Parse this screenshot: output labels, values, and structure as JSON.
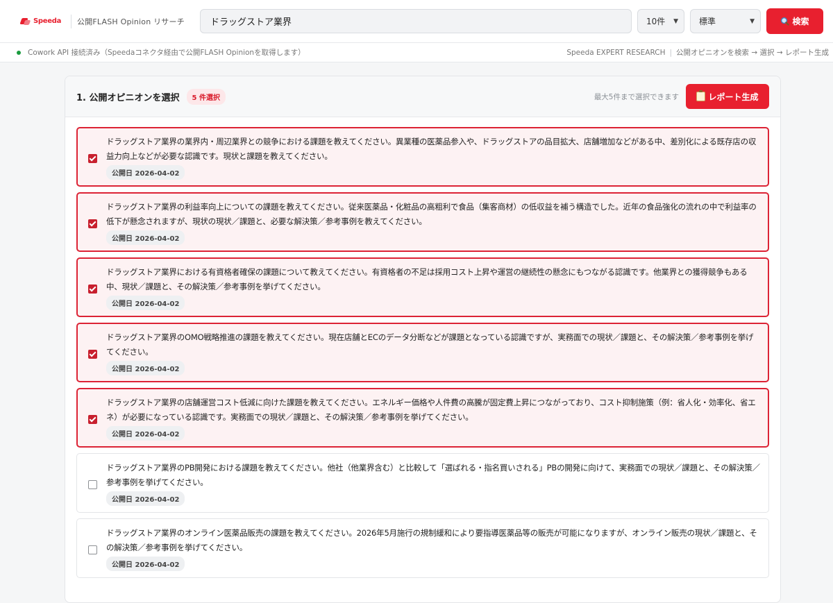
{
  "header": {
    "logo_text": "Speeda",
    "app_name": "公開FLASH Opinion リサーチ",
    "search_value": "ドラッグストア業界",
    "count_select": "10件",
    "mode_select": "標準",
    "search_button": "検索"
  },
  "status": {
    "connection": "Cowork API 接続済み（Speedaコネクタ経由で公開FLASH Opinionを取得します）",
    "brand": "Speeda EXPERT RESEARCH",
    "flow": "公開オピニオンを検索 → 選択 → レポート生成"
  },
  "panel": {
    "title": "1. 公開オピニオンを選択",
    "selected_badge": "5 件選択",
    "limit_note": "最大5件まで選択できます",
    "report_button": "レポート生成"
  },
  "items": [
    {
      "text": "ドラッグストア業界の業界内・周辺業界との競争における課題を教えてください。異業種の医薬品参入や、ドラッグストアの品目拡大、店舗増加などがある中、差別化による既存店の収益力向上などが必要な認識です。現状と課題を教えてください。",
      "date": "公開日 2026-04-02",
      "checked": true
    },
    {
      "text": "ドラッグストア業界の利益率向上についての課題を教えてください。従来医薬品・化粧品の高粗利で食品（集客商材）の低収益を補う構造でした。近年の食品強化の流れの中で利益率の低下が懸念されますが、現状の現状／課題と、必要な解決策／参考事例を教えてください。",
      "date": "公開日 2026-04-02",
      "checked": true
    },
    {
      "text": "ドラッグストア業界における有資格者確保の課題について教えてください。有資格者の不足は採用コスト上昇や運営の継続性の懸念にもつながる認識です。他業界との獲得競争もある中、現状／課題と、その解決策／参考事例を挙げてください。",
      "date": "公開日 2026-04-02",
      "checked": true
    },
    {
      "text": "ドラッグストア業界のOMO戦略推進の課題を教えてください。現在店舗とECのデータ分断などが課題となっている認識ですが、実務面での現状／課題と、その解決策／参考事例を挙げてください。",
      "date": "公開日 2026-04-02",
      "checked": true
    },
    {
      "text": "ドラッグストア業界の店舗運営コスト低減に向けた課題を教えてください。エネルギー価格や人件費の高騰が固定費上昇につながっており、コスト抑制施策（例：省人化・効率化、省エネ）が必要になっている認識です。実務面での現状／課題と、その解決策／参考事例を挙げてください。",
      "date": "公開日 2026-04-02",
      "checked": true
    },
    {
      "text": "ドラッグストア業界のPB開発における課題を教えてください。他社（他業界含む）と比較して「選ばれる・指名買いされる」PBの開発に向けて、実務面での現状／課題と、その解決策／参考事例を挙げてください。",
      "date": "公開日 2026-04-02",
      "checked": false
    },
    {
      "text": "ドラッグストア業界のオンライン医薬品販売の課題を教えてください。2026年5月施行の規制緩和により要指導医薬品等の販売が可能になりますが、オンライン販売の現状／課題と、その解決策／参考事例を挙げてください。",
      "date": "公開日 2026-04-02",
      "checked": false
    }
  ]
}
